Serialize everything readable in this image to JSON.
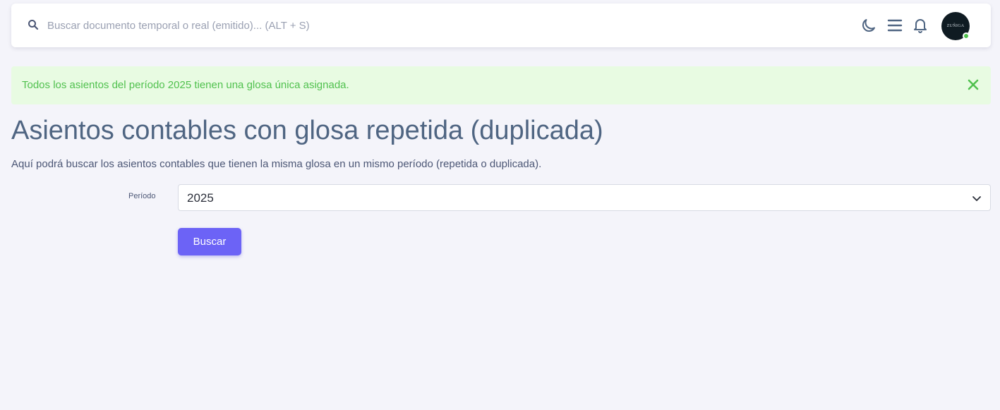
{
  "topbar": {
    "search": {
      "placeholder": "Buscar documento temporal o real (emitido)... (ALT + S)",
      "value": ""
    },
    "icons": [
      "search-icon",
      "moon-icon",
      "menu-icon",
      "bell-icon"
    ],
    "avatar": {
      "text": "ZUÑIGA",
      "status": "online",
      "status_color": "#50c14e"
    }
  },
  "alert": {
    "message": "Todos los asientos del período 2025 tienen una glosa única asignada.",
    "color": "#50c14e",
    "background": "#e8fbe2"
  },
  "page": {
    "title": "Asientos contables con glosa repetida (duplicada)",
    "description": "Aquí podrá buscar los asientos contables que tienen la misma glosa en un mismo período (repetida o duplicada)."
  },
  "form": {
    "period_label": "Período",
    "period_value": "2025",
    "submit_label": "Buscar",
    "accent": "#6c63f6"
  }
}
